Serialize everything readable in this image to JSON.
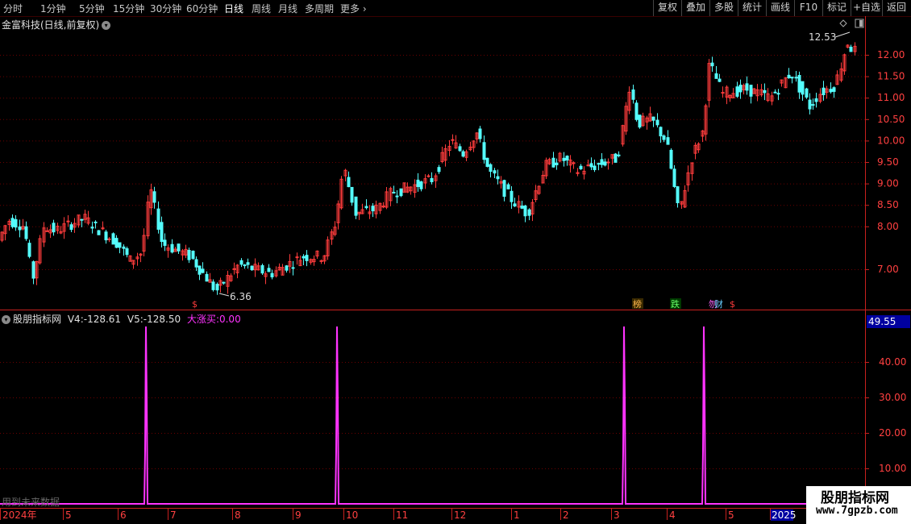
{
  "toolbar": {
    "periods": [
      "分时",
      "1分钟",
      "5分钟",
      "15分钟",
      "30分钟",
      "60分钟",
      "日线",
      "周线",
      "月线",
      "多周期",
      "更多"
    ],
    "active_period": "日线",
    "right_buttons": [
      "复权",
      "叠加",
      "多股",
      "统计",
      "画线",
      "F10",
      "标记",
      "+自选",
      "返回"
    ]
  },
  "main_chart": {
    "title": "金富科技(日线,前复权)",
    "price_ticks": [
      "12.00",
      "11.50",
      "11.00",
      "10.50",
      "10.00",
      "9.50",
      "9.00",
      "8.50",
      "8.00",
      "7.00"
    ],
    "high_label": "12.53",
    "low_label": "6.36",
    "markers": [
      "$",
      "榜",
      "跌",
      "刎",
      "财",
      "$"
    ]
  },
  "indicator": {
    "name": "股朋指标网",
    "v4_label": "V4:",
    "v4_value": "-128.61",
    "v5_label": "V5:",
    "v5_value": "-128.50",
    "buy_label": "大涨买:",
    "buy_value": "0.00",
    "current_value": "49.55",
    "ticks": [
      "40.00",
      "30.00",
      "20.00",
      "10.00"
    ],
    "future_text": "用到未来数据"
  },
  "date_axis": {
    "labels": [
      "2024年",
      "5",
      "6",
      "7",
      "8",
      "9",
      "10",
      "11",
      "12",
      "1",
      "2",
      "3",
      "4",
      "5",
      "2025"
    ]
  },
  "watermark": {
    "line1": "股朋指标网",
    "line2": "www.7gpzb.com"
  },
  "colors": {
    "up": "#ff3c3c",
    "down": "#54fcfc",
    "indicator": "#ff33ff",
    "grid": "#8b0000",
    "axis": "#c8201e"
  }
}
